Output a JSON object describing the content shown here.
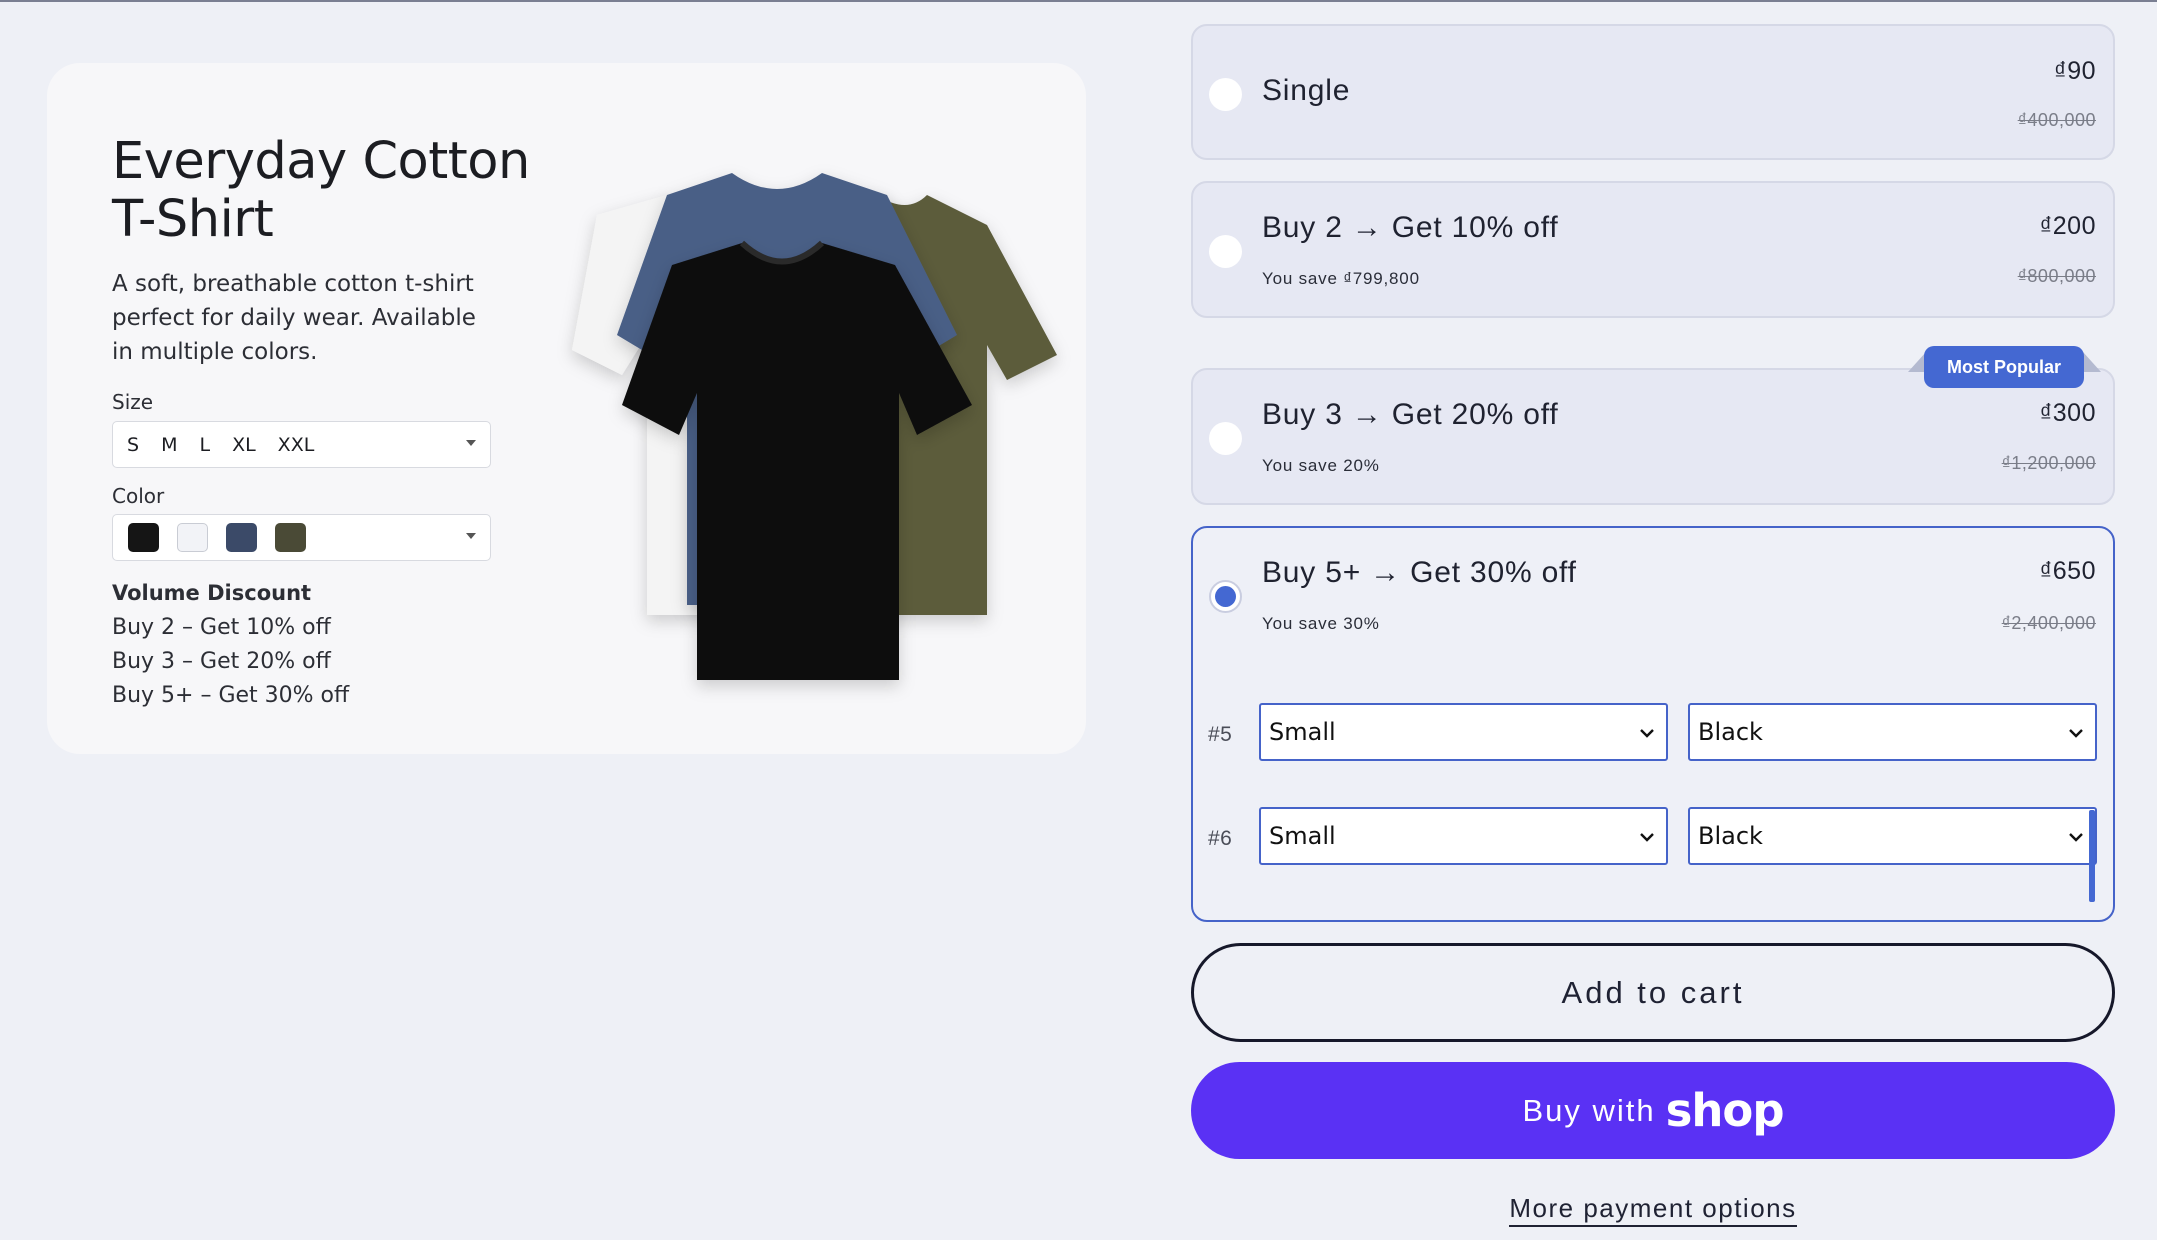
{
  "product": {
    "title": "Everyday Cotton T-Shirt",
    "description": "A soft, breathable cotton t-shirt perfect for daily wear. Available in multiple colors.",
    "size_label": "Size",
    "sizes": [
      "S",
      "M",
      "L",
      "XL",
      "XXL"
    ],
    "color_label": "Color",
    "swatch_colors": [
      "#151515",
      "#f2f3f7",
      "#3b4a68",
      "#4a4a36"
    ],
    "volume_discount_title": "Volume Discount",
    "volume_discount_lines": [
      "Buy 2 – Get 10% off",
      "Buy 3 – Get 20% off",
      "Buy 5+ – Get 30% off"
    ]
  },
  "options": [
    {
      "title": "Single",
      "subtitle": "",
      "price": "₫90",
      "compare_price": "₫400,000",
      "selected": false
    },
    {
      "title": "Buy 2 → Get 10% off",
      "subtitle": "You save ₫799,800",
      "price": "₫200",
      "compare_price": "₫800,000",
      "selected": false
    },
    {
      "title": "Buy 3 → Get 20% off",
      "subtitle": "You save 20%",
      "price": "₫300",
      "compare_price": "₫1,200,000",
      "selected": false,
      "badge": "Most Popular"
    },
    {
      "title": "Buy 5+ → Get 30% off",
      "subtitle": "You save 30%",
      "price": "₫650",
      "compare_price": "₫2,400,000",
      "selected": true
    }
  ],
  "variant_rows": [
    {
      "number": "#5",
      "size": "Small",
      "color": "Black"
    },
    {
      "number": "#6",
      "size": "Small",
      "color": "Black"
    }
  ],
  "buttons": {
    "add_to_cart": "Add to cart",
    "buy_with": "Buy with",
    "shop_logo": "shop",
    "more_payment": "More payment options"
  },
  "colors": {
    "accent": "#4468d2",
    "shop_purple": "#5a31f4",
    "background": "#eef0f6"
  }
}
